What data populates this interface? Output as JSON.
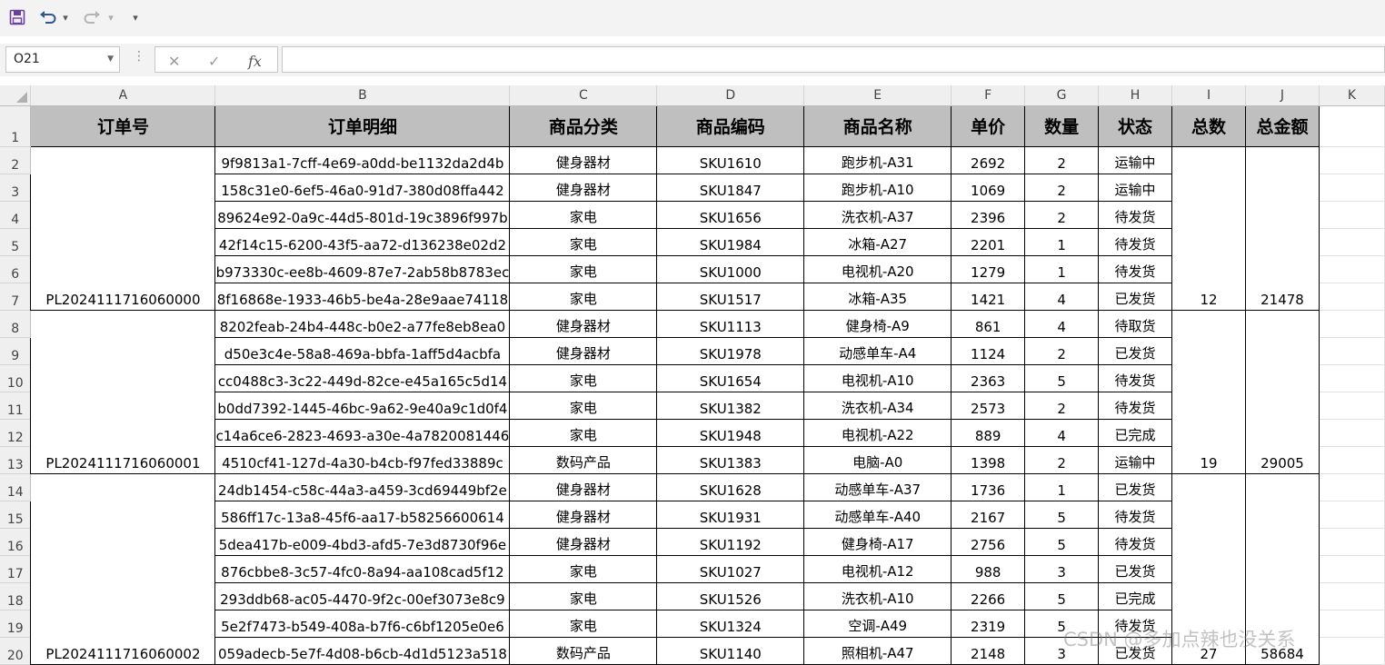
{
  "toolbar": {
    "save_icon": "save-icon",
    "undo_icon": "undo-icon",
    "redo_icon": "redo-icon",
    "customize_icon": "customize-qat-icon",
    "undo_arrow": "▾",
    "redo_arrow": "▾",
    "customize_glyph": "▾"
  },
  "formula_bar": {
    "name_box": "O21",
    "cancel_glyph": "✕",
    "enter_glyph": "✓",
    "fx_label": "fx",
    "dots": "⋮",
    "formula": ""
  },
  "columns": [
    "A",
    "B",
    "C",
    "D",
    "E",
    "F",
    "G",
    "H",
    "I",
    "J",
    "K"
  ],
  "header_row": {
    "row_num": "1",
    "cells": [
      "订单号",
      "订单明细",
      "商品分类",
      "商品编码",
      "商品名称",
      "单价",
      "数量",
      "状态",
      "总数",
      "总金额"
    ]
  },
  "groups": [
    {
      "order_id": "PL2024111716060000",
      "total_qty": "12",
      "total_amount": "21478",
      "rows": [
        {
          "row_num": "2",
          "detail": "9f9813a1-7cff-4e69-a0dd-be1132da2d4b",
          "category": "健身器材",
          "sku": "SKU1610",
          "name": "跑步机-A31",
          "price": "2692",
          "qty": "2",
          "status": "运输中"
        },
        {
          "row_num": "3",
          "detail": "158c31e0-6ef5-46a0-91d7-380d08ffa442",
          "category": "健身器材",
          "sku": "SKU1847",
          "name": "跑步机-A10",
          "price": "1069",
          "qty": "2",
          "status": "运输中"
        },
        {
          "row_num": "4",
          "detail": "89624e92-0a9c-44d5-801d-19c3896f997b",
          "category": "家电",
          "sku": "SKU1656",
          "name": "洗衣机-A37",
          "price": "2396",
          "qty": "2",
          "status": "待发货"
        },
        {
          "row_num": "5",
          "detail": "42f14c15-6200-43f5-aa72-d136238e02d2",
          "category": "家电",
          "sku": "SKU1984",
          "name": "冰箱-A27",
          "price": "2201",
          "qty": "1",
          "status": "待发货"
        },
        {
          "row_num": "6",
          "detail": "b973330c-ee8b-4609-87e7-2ab58b8783ec",
          "category": "家电",
          "sku": "SKU1000",
          "name": "电视机-A20",
          "price": "1279",
          "qty": "1",
          "status": "待发货"
        },
        {
          "row_num": "7",
          "detail": "8f16868e-1933-46b5-be4a-28e9aae74118",
          "category": "家电",
          "sku": "SKU1517",
          "name": "冰箱-A35",
          "price": "1421",
          "qty": "4",
          "status": "已发货"
        }
      ]
    },
    {
      "order_id": "PL2024111716060001",
      "total_qty": "19",
      "total_amount": "29005",
      "rows": [
        {
          "row_num": "8",
          "detail": "8202feab-24b4-448c-b0e2-a77fe8eb8ea0",
          "category": "健身器材",
          "sku": "SKU1113",
          "name": "健身椅-A9",
          "price": "861",
          "qty": "4",
          "status": "待取货"
        },
        {
          "row_num": "9",
          "detail": "d50e3c4e-58a8-469a-bbfa-1aff5d4acbfa",
          "category": "健身器材",
          "sku": "SKU1978",
          "name": "动感单车-A4",
          "price": "1124",
          "qty": "2",
          "status": "已发货"
        },
        {
          "row_num": "10",
          "detail": "cc0488c3-3c22-449d-82ce-e45a165c5d14",
          "category": "家电",
          "sku": "SKU1654",
          "name": "电视机-A10",
          "price": "2363",
          "qty": "5",
          "status": "待发货"
        },
        {
          "row_num": "11",
          "detail": "b0dd7392-1445-46bc-9a62-9e40a9c1d0f4",
          "category": "家电",
          "sku": "SKU1382",
          "name": "洗衣机-A34",
          "price": "2573",
          "qty": "2",
          "status": "待发货"
        },
        {
          "row_num": "12",
          "detail": "c14a6ce6-2823-4693-a30e-4a7820081446",
          "category": "家电",
          "sku": "SKU1948",
          "name": "电视机-A22",
          "price": "889",
          "qty": "4",
          "status": "已完成"
        },
        {
          "row_num": "13",
          "detail": "4510cf41-127d-4a30-b4cb-f97fed33889c",
          "category": "数码产品",
          "sku": "SKU1383",
          "name": "电脑-A0",
          "price": "1398",
          "qty": "2",
          "status": "运输中"
        }
      ]
    },
    {
      "order_id": "PL2024111716060002",
      "total_qty": "27",
      "total_amount": "58684",
      "rows": [
        {
          "row_num": "14",
          "detail": "24db1454-c58c-44a3-a459-3cd69449bf2e",
          "category": "健身器材",
          "sku": "SKU1628",
          "name": "动感单车-A37",
          "price": "1736",
          "qty": "1",
          "status": "已发货"
        },
        {
          "row_num": "15",
          "detail": "586ff17c-13a8-45f6-aa17-b58256600614",
          "category": "健身器材",
          "sku": "SKU1931",
          "name": "动感单车-A40",
          "price": "2167",
          "qty": "5",
          "status": "待发货"
        },
        {
          "row_num": "16",
          "detail": "5dea417b-e009-4bd3-afd5-7e3d8730f96e",
          "category": "健身器材",
          "sku": "SKU1192",
          "name": "健身椅-A17",
          "price": "2756",
          "qty": "5",
          "status": "待发货"
        },
        {
          "row_num": "17",
          "detail": "876cbbe8-3c57-4fc0-8a94-aa108cad5f12",
          "category": "家电",
          "sku": "SKU1027",
          "name": "电视机-A12",
          "price": "988",
          "qty": "3",
          "status": "已发货"
        },
        {
          "row_num": "18",
          "detail": "293ddb68-ac05-4470-9f2c-00ef3073e8c9",
          "category": "家电",
          "sku": "SKU1526",
          "name": "洗衣机-A10",
          "price": "2266",
          "qty": "5",
          "status": "已完成"
        },
        {
          "row_num": "19",
          "detail": "5e2f7473-b549-408a-b7f6-c6bf1205e0e6",
          "category": "家电",
          "sku": "SKU1324",
          "name": "空调-A49",
          "price": "2319",
          "qty": "5",
          "status": "待发货"
        },
        {
          "row_num": "20",
          "detail": "059adecb-5e7f-4d08-b6cb-4d1d5123a518",
          "category": "数码产品",
          "sku": "SKU1140",
          "name": "照相机-A47",
          "price": "2148",
          "qty": "3",
          "status": "已发货"
        }
      ]
    }
  ],
  "watermark": "CSDN @多加点辣也没关系",
  "colors": {
    "header_fill": "#bfbfbf",
    "grid_line": "#000000",
    "chrome_bg": "#f3f3f3",
    "icon_blue": "#2f5597"
  }
}
